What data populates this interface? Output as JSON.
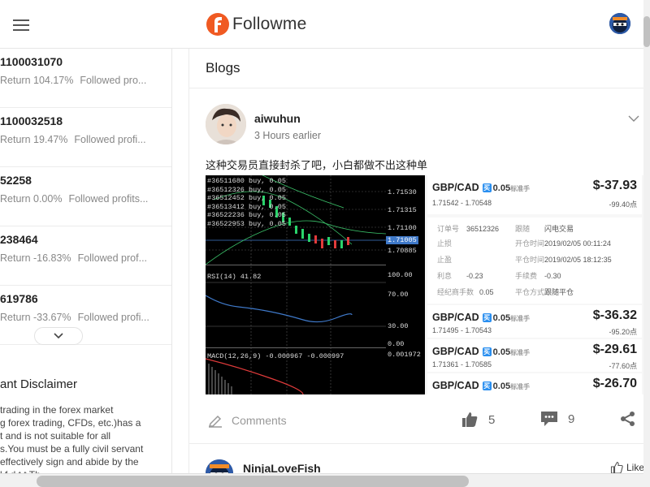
{
  "header": {
    "brand_name": "Followme",
    "brand_color": "#f05a22"
  },
  "traders": [
    {
      "id": "1100031070",
      "return_label": "Return 104.17%",
      "followed_label": "Followed pro..."
    },
    {
      "id": "1100032518",
      "return_label": "Return 19.47%",
      "followed_label": "Followed profi..."
    },
    {
      "id": "52258",
      "return_label": "Return 0.00%",
      "followed_label": "Followed profits..."
    },
    {
      "id": "238464",
      "return_label": "Return -16.83%",
      "followed_label": "Followed prof..."
    },
    {
      "id": "619786",
      "return_label": "Return -33.67%",
      "followed_label": "Followed profi..."
    }
  ],
  "disclaimer": {
    "title": "ant Disclaimer",
    "lines": [
      "trading in the forex market",
      "g forex trading, CFDs, etc.)has a",
      "t and is not suitable for all",
      "s.You must be a fully civil servant",
      " effectively sign and abide by the",
      "      l       f     d    t  t  Th"
    ]
  },
  "blogs": {
    "title": "Blogs",
    "post": {
      "author": "aiwuhun",
      "time": "3 Hours earlier",
      "text": "这种交易员直接封杀了吧，小白都做不出这种单",
      "comments_label": "Comments",
      "likes": "5",
      "comments": "9"
    },
    "post2": {
      "author": "NinjaLoveFish",
      "like_label": "Like"
    }
  },
  "chart_screenshot": {
    "orders": [
      "#36511680 buy, 0.05",
      "#36512326 buy, 0.05",
      "#36512452 buy, 0.05",
      "#36513412 buy, 0.05",
      "#36522236 buy, 0.05",
      "#36522953 buy, 0.05"
    ],
    "price_ticks": [
      "1.71530",
      "1.71315",
      "1.71100",
      "1.70885"
    ],
    "current_price": "1.71005",
    "rsi_label": "RSI(14) 41.82",
    "rsi_ticks": [
      "100.00",
      "70.00",
      "30.00",
      "0.00"
    ],
    "macd_label": "MACD(12,26,9) -0.000967 -0.000997",
    "macd_tick": "0.001972"
  },
  "trades": [
    {
      "pair": "GBP/CAD",
      "lot": "0.05",
      "lot_tag": "标准手",
      "pnl": "$-37.93",
      "range": "1.71542 - 1.70548",
      "points": "-99.40点"
    },
    {
      "pair": "GBP/CAD",
      "lot": "0.05",
      "lot_tag": "标准手",
      "pnl": "$-36.32",
      "range": "1.71495 - 1.70543",
      "points": "-95.20点"
    },
    {
      "pair": "GBP/CAD",
      "lot": "0.05",
      "lot_tag": "标准手",
      "pnl": "$-29.61",
      "range": "1.71361 - 1.70585",
      "points": "-77.60点"
    },
    {
      "pair": "GBP/CAD",
      "lot": "0.05",
      "lot_tag": "标准手",
      "pnl": "$-26.70",
      "range": "",
      "points": ""
    }
  ],
  "trade_detail": {
    "order_no_label": "订单号",
    "order_no": "36512326",
    "follow_label": "跟随",
    "follow_value": "闪电交易",
    "sl_label": "止损",
    "open_time_label": "开仓时间",
    "open_time": "2019/02/05 00:11:24",
    "tp_label": "止盈",
    "close_time_label": "平仓时间",
    "close_time": "2019/02/05 18:12:35",
    "interest_label": "利息",
    "interest": "-0.23",
    "fee_label": "手续费",
    "fee": "-0.30",
    "broker_fee_label": "经纪商手数",
    "broker_fee": "0.05",
    "close_mode_label": "平仓方式",
    "close_mode": "跟随平仓"
  }
}
